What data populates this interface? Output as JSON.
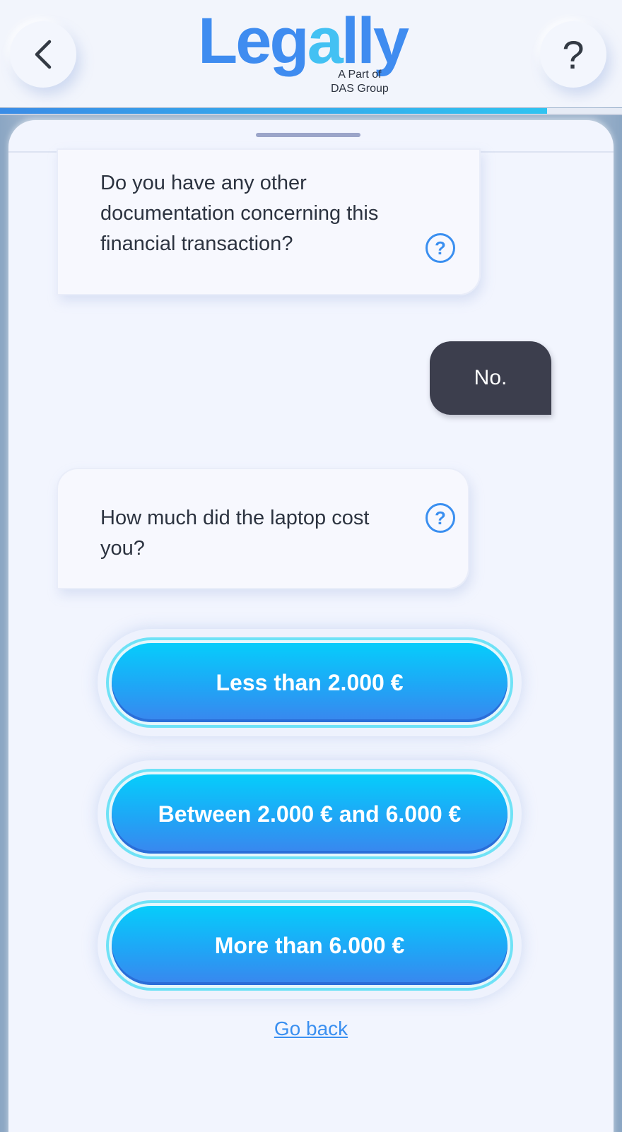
{
  "header": {
    "back_icon": "chevron-left-icon",
    "help_label": "?",
    "logo_text_a": "Leg",
    "logo_text_b": "a",
    "logo_text_c": "lly",
    "logo_sub_line1": "A Part of",
    "logo_sub_line2": "DAS Group",
    "progress": 0.88,
    "brand_color": "#3f8cf0",
    "brand_accent": "#43c1f3"
  },
  "chat": {
    "messages": [
      {
        "from": "bot",
        "text": "Do you have any other documentation concerning this financial transaction?",
        "icon": "question-circle-icon"
      },
      {
        "from": "user",
        "text": "No."
      },
      {
        "from": "bot",
        "text": "How much did the laptop cost you?",
        "icon": "question-circle-icon"
      }
    ]
  },
  "options": [
    {
      "label": "Less than 2.000 €"
    },
    {
      "label": "Between 2.000 € and 6.000 €"
    },
    {
      "label": "More than 6.000 €"
    }
  ],
  "footer": {
    "go_back_label": "Go back"
  },
  "colors": {
    "option_top": "#06cdfb",
    "option_bottom": "#3a86ee",
    "user_bubble": "#3c3e4d",
    "link": "#3a8ff0"
  }
}
